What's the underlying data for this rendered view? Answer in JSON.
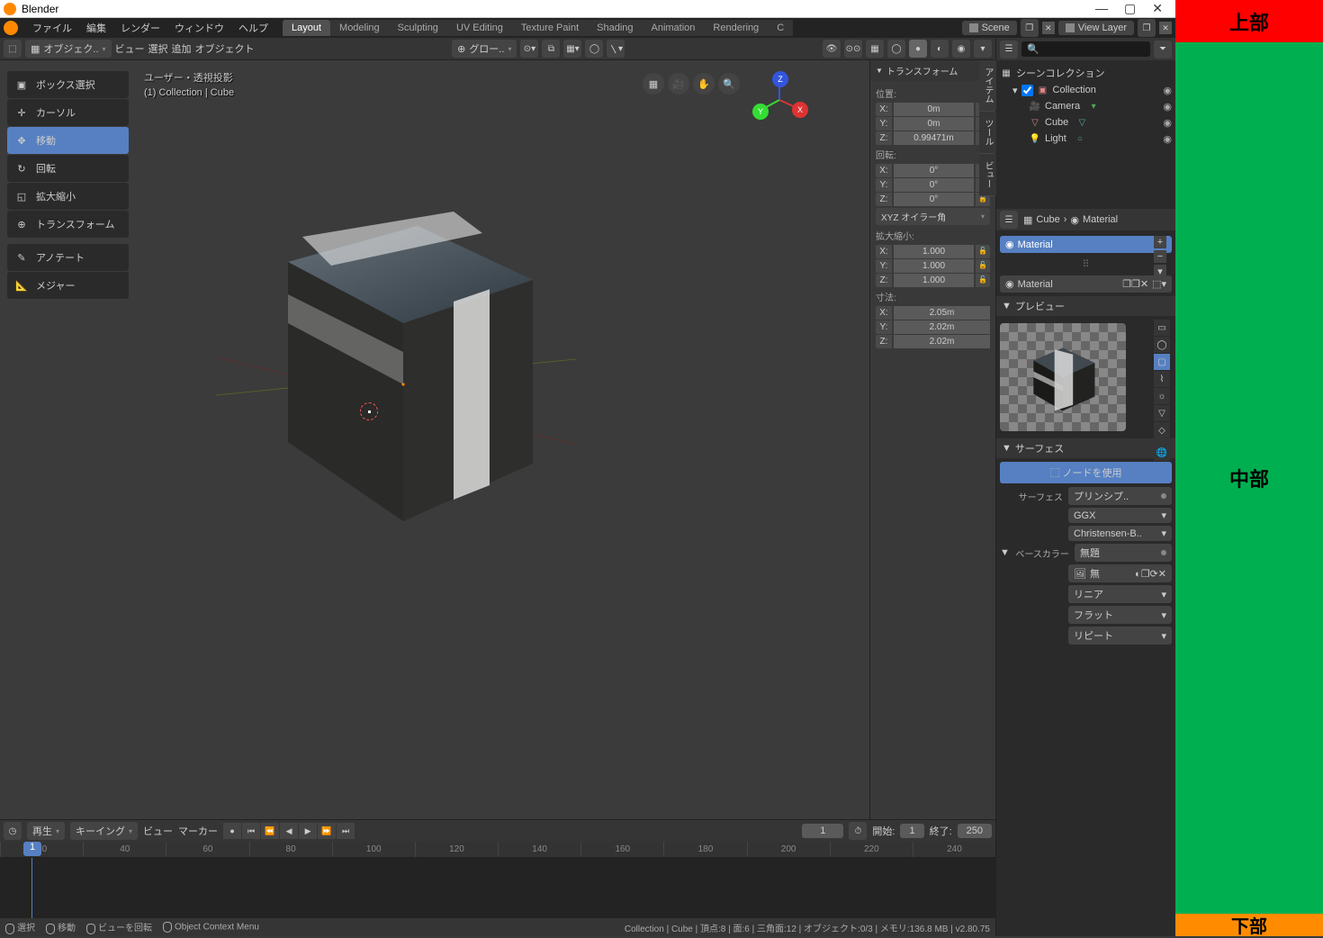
{
  "labels": {
    "top": "上部",
    "mid": "中部",
    "bot": "下部"
  },
  "window": {
    "title": "Blender"
  },
  "menu": {
    "file": "ファイル",
    "edit": "編集",
    "render": "レンダー",
    "window": "ウィンドウ",
    "help": "ヘルプ"
  },
  "tabs": [
    "Layout",
    "Modeling",
    "Sculpting",
    "UV Editing",
    "Texture Paint",
    "Shading",
    "Animation",
    "Rendering",
    "C"
  ],
  "scene": {
    "label": "Scene",
    "layer": "View Layer"
  },
  "header": {
    "mode": "オブジェク..",
    "view": "ビュー",
    "select": "選択",
    "add": "追加",
    "object": "オブジェクト",
    "orient": "グロー.."
  },
  "vp": {
    "info1": "ユーザー・透視投影",
    "info2": "(1) Collection | Cube",
    "tools": {
      "box": "ボックス選択",
      "cursor": "カーソル",
      "move": "移動",
      "rotate": "回転",
      "scale": "拡大縮小",
      "transform": "トランスフォーム",
      "annotate": "アノテート",
      "measure": "メジャー"
    }
  },
  "npanel": {
    "tabs": {
      "item": "アイテム",
      "tool": "ツール",
      "view": "ビュー"
    },
    "transform": "トランスフォーム",
    "location": "位置:",
    "rotation": "回転:",
    "scale": "拡大縮小:",
    "dimensions": "寸法:",
    "rot_mode": "XYZ オイラー角",
    "loc": {
      "x": "0m",
      "y": "0m",
      "z": "0.99471m"
    },
    "rot": {
      "x": "0°",
      "y": "0°",
      "z": "0°"
    },
    "scl": {
      "x": "1.000",
      "y": "1.000",
      "z": "1.000"
    },
    "dim": {
      "x": "2.05m",
      "y": "2.02m",
      "z": "2.02m"
    }
  },
  "outliner": {
    "scene_col": "シーンコレクション",
    "collection": "Collection",
    "camera": "Camera",
    "cube": "Cube",
    "light": "Light"
  },
  "props": {
    "crumb_cube": "Cube",
    "crumb_mat": "Material",
    "slot": "Material",
    "mat_name": "Material",
    "preview": "プレビュー",
    "surface_head": "サーフェス",
    "use_nodes": "ノードを使用",
    "surface": "サーフェス",
    "surface_val": "プリンシプ..",
    "ggx": "GGX",
    "cb": "Christensen-B..",
    "basecolor": "ベースカラー",
    "basecolor_val": "無題",
    "mu": "無",
    "linear": "リニア",
    "flat": "フラット",
    "repeat": "リピート"
  },
  "timeline": {
    "play": "再生",
    "keying": "キーイング",
    "view": "ビュー",
    "marker": "マーカー",
    "start_lbl": "開始:",
    "end_lbl": "終了:",
    "current": "1",
    "start": "1",
    "end": "250",
    "ticks": [
      "20",
      "40",
      "60",
      "80",
      "100",
      "120",
      "140",
      "160",
      "180",
      "200",
      "220",
      "240"
    ]
  },
  "status": {
    "select": "選択",
    "move": "移動",
    "rotate_view": "ビューを回転",
    "ctx": "Object Context Menu",
    "right": "Collection | Cube | 頂点:8 | 面:6 | 三角面:12 | オブジェクト:0/3 | メモリ:136.8 MB | v2.80.75"
  }
}
